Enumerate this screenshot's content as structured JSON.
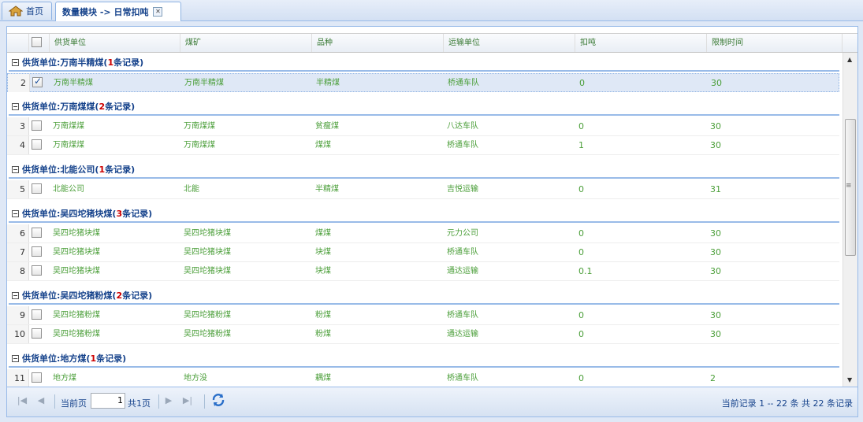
{
  "tabs": [
    {
      "label": "首页"
    },
    {
      "label": "数量模块 -> 日常扣吨"
    }
  ],
  "grid": {
    "columns": [
      "供货单位",
      "煤矿",
      "品种",
      "运输单位",
      "扣吨",
      "限制时间"
    ],
    "group_prefix": "供货单位: ",
    "groups": [
      {
        "name": "万南半精煤",
        "count": "1",
        "count_suffix": " 条记录)",
        "rows": [
          {
            "rn": "2",
            "checked": true,
            "selected": true,
            "cells": [
              "万南半精煤",
              "万南半精煤",
              "半精煤",
              "桥通车队",
              "0",
              "30"
            ]
          }
        ]
      },
      {
        "name": "万南煤煤",
        "count": "2",
        "count_suffix": " 条记录)",
        "rows": [
          {
            "rn": "3",
            "checked": false,
            "cells": [
              "万南煤煤",
              "万南煤煤",
              "贫瘦煤",
              "八达车队",
              "0",
              "30"
            ]
          },
          {
            "rn": "4",
            "checked": false,
            "cells": [
              "万南煤煤",
              "万南煤煤",
              "煤煤",
              "桥通车队",
              "1",
              "30"
            ]
          }
        ]
      },
      {
        "name": "北能公司",
        "count": "1",
        "count_suffix": " 条记录)",
        "rows": [
          {
            "rn": "5",
            "checked": false,
            "cells": [
              "北能公司",
              "北能",
              "半精煤",
              "吉悦运输",
              "0",
              "31"
            ]
          }
        ]
      },
      {
        "name": "吴四坨猪块煤",
        "count": "3",
        "count_suffix": " 条记录)",
        "rows": [
          {
            "rn": "6",
            "checked": false,
            "cells": [
              "吴四坨猪块煤",
              "吴四坨猪块煤",
              "煤煤",
              "元力公司",
              "0",
              "30"
            ]
          },
          {
            "rn": "7",
            "checked": false,
            "cells": [
              "吴四坨猪块煤",
              "吴四坨猪块煤",
              "块煤",
              "桥通车队",
              "0",
              "30"
            ]
          },
          {
            "rn": "8",
            "checked": false,
            "cells": [
              "吴四坨猪块煤",
              "吴四坨猪块煤",
              "块煤",
              "通达运输",
              "0.1",
              "30"
            ]
          }
        ]
      },
      {
        "name": "吴四坨猪粉煤",
        "count": "2",
        "count_suffix": " 条记录)",
        "rows": [
          {
            "rn": "9",
            "checked": false,
            "cells": [
              "吴四坨猪粉煤",
              "吴四坨猪粉煤",
              "粉煤",
              "桥通车队",
              "0",
              "30"
            ]
          },
          {
            "rn": "10",
            "checked": false,
            "cells": [
              "吴四坨猪粉煤",
              "吴四坨猪粉煤",
              "粉煤",
              "通达运输",
              "0",
              "30"
            ]
          }
        ]
      },
      {
        "name": "地方煤",
        "count": "1",
        "count_suffix": " 条记录)",
        "rows": [
          {
            "rn": "11",
            "checked": false,
            "cells": [
              "地方煤",
              "地方没",
              "耦煤",
              "桥通车队",
              "0",
              "2"
            ]
          }
        ]
      }
    ]
  },
  "pager": {
    "current_label": "当前页",
    "page_value": "1",
    "total_pages": "共1页",
    "summary": "当前记录 1 -- 22 条 共 22 条记录"
  },
  "colors": {
    "accent": "#15428b",
    "cell_text": "#4a9e38",
    "count": "#cc0000"
  }
}
